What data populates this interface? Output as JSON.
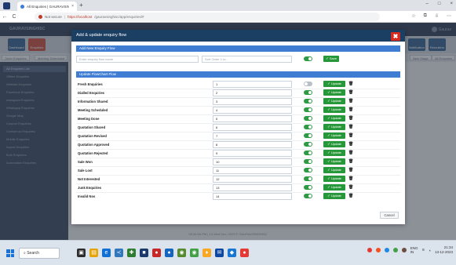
{
  "browser": {
    "tab_title": "All Enquiries | GAURAVSINGHISC",
    "tab_close": "×",
    "new_tab": "+",
    "url_not_secure": "Not secure",
    "url_host": "https://localhost",
    "url_path": "/gauravsinghisc/app/enquiries/#",
    "back": "←",
    "reload": "C",
    "controls": [
      "–",
      "□",
      "×"
    ]
  },
  "app": {
    "brand": "GAURAVSINGHISC",
    "user": "Gaurav",
    "toolbar": [
      "Dashboard",
      "Enquiries",
      "Notification",
      "Recruiters"
    ],
    "crumbs": [
      "Open Enquiries",
      "Meeting Scheduled",
      "New Stage",
      "All Enquiries"
    ],
    "sidebar": [
      "All Enquiries List",
      "Offline Enquiries",
      "Website Enquiries",
      "Facebook Enquiries",
      "Instagram Enquiries",
      "Whatsapp Enquiries",
      "Google Map",
      "Coupon Enquiries",
      "Contact us Enquiries",
      "Mobile Enquiries",
      "Import Enquiries",
      "Bulk Enquiries",
      "Automation Enquiries"
    ],
    "status": "09:34:56 PM | 13 Wed Dec, 2023 © GAURAVSINGHISC"
  },
  "modal": {
    "title": "Add & update enquiry flow",
    "close": "✖",
    "add_section": "Add New Enquiry Flow",
    "name_placeholder": "Enter enquiry flow name",
    "sort_placeholder": "Sort Order 1 to -",
    "save_label": "Save",
    "flowchart_section": "Update FlowChart Flow",
    "update_label": "Update",
    "delete_icon": "🗑",
    "cancel_label": "Cancel",
    "rows": [
      {
        "name": "Fresh Enquiries",
        "order": "1",
        "enabled": false
      },
      {
        "name": "Dialled Enquiries",
        "order": "2",
        "enabled": true
      },
      {
        "name": "Information Shared",
        "order": "3",
        "enabled": true
      },
      {
        "name": "Meeting Scheduled",
        "order": "4",
        "enabled": true
      },
      {
        "name": "Meeting Done",
        "order": "5",
        "enabled": true
      },
      {
        "name": "Quotation Shared",
        "order": "6",
        "enabled": true
      },
      {
        "name": "Quotation Revised",
        "order": "7",
        "enabled": true
      },
      {
        "name": "Quotation Approved",
        "order": "8",
        "enabled": true
      },
      {
        "name": "Quotation Rejected",
        "order": "9",
        "enabled": true
      },
      {
        "name": "Sale Won",
        "order": "10",
        "enabled": true
      },
      {
        "name": "Sale Lost",
        "order": "11",
        "enabled": true
      },
      {
        "name": "Not Interested",
        "order": "12",
        "enabled": true
      },
      {
        "name": "Junk Enquiries",
        "order": "13",
        "enabled": true
      },
      {
        "name": "Invalid Nos",
        "order": "14",
        "enabled": true
      }
    ]
  },
  "taskbar": {
    "search": "Search",
    "lang": "ENG",
    "region": "IN",
    "time": "21:34",
    "date": "13-12-2023"
  },
  "colors": {
    "modal_header": "#1b3e63",
    "section_header": "#3f7dd2",
    "green": "#27983a",
    "close_red": "#d62a20"
  }
}
